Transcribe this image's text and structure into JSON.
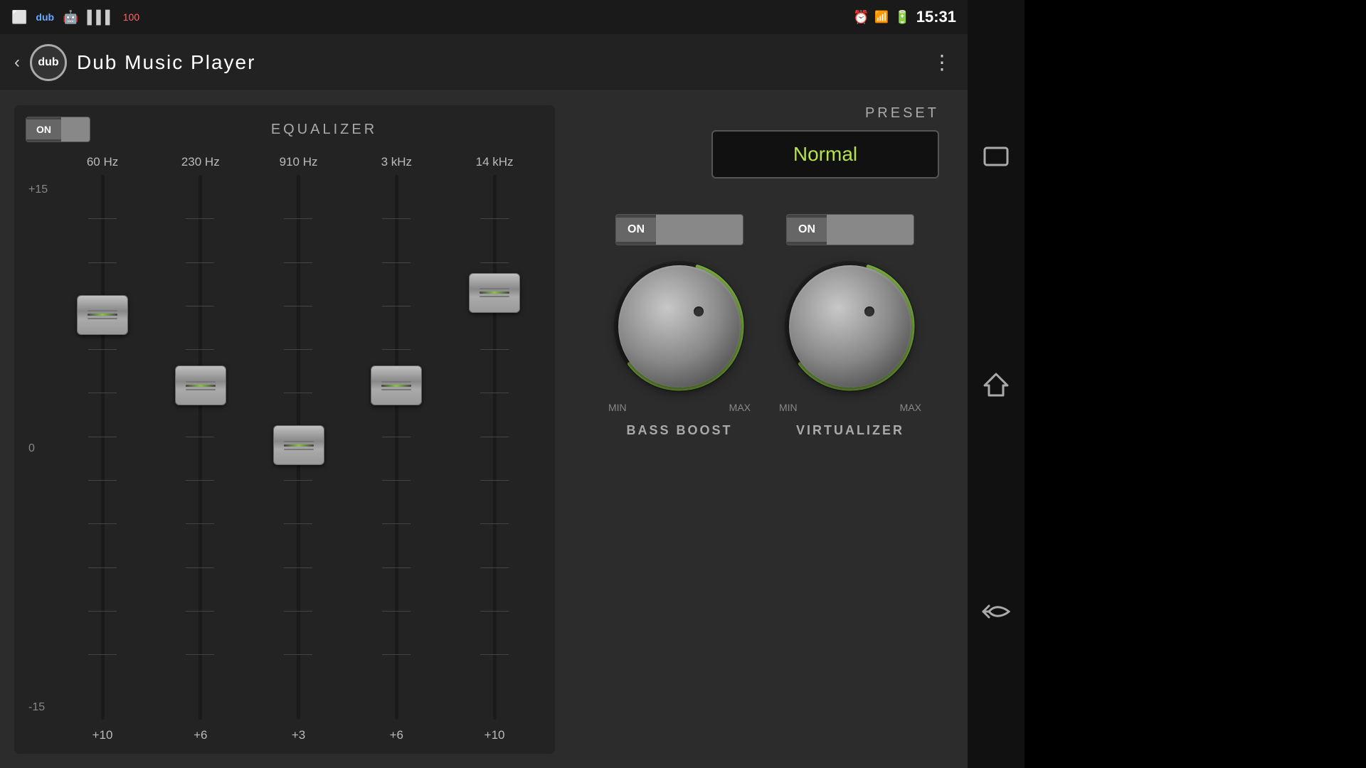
{
  "statusBar": {
    "time": "15:31",
    "icons": [
      "alarm-icon",
      "signal-icon",
      "battery-icon"
    ]
  },
  "header": {
    "appName": "Dub Music Player",
    "logo": "dub",
    "menuIcon": "⋮"
  },
  "equalizer": {
    "toggleLabel": "ON",
    "sectionLabel": "EQUALIZER",
    "presetLabel": "PRESET",
    "presetValue": "Normal",
    "bands": [
      {
        "freq": "60 Hz",
        "value": "+10",
        "position": 25
      },
      {
        "freq": "230 Hz",
        "value": "+6",
        "position": 40
      },
      {
        "freq": "910 Hz",
        "value": "+3",
        "position": 55
      },
      {
        "freq": "3 kHz",
        "value": "+6",
        "position": 40
      },
      {
        "freq": "14 kHz",
        "value": "+10",
        "position": 20
      }
    ],
    "scaleLabels": [
      "+15",
      "0",
      "-15"
    ]
  },
  "bassBoost": {
    "toggleLabel": "ON",
    "minLabel": "MIN",
    "maxLabel": "MAX",
    "name": "BASS BOOST",
    "knobPosition": 65
  },
  "virtualizer": {
    "toggleLabel": "ON",
    "minLabel": "MIN",
    "maxLabel": "MAX",
    "name": "VIRTUALIZER",
    "knobPosition": 65
  },
  "navigation": {
    "buttons": [
      "recent-apps-icon",
      "home-icon",
      "back-icon"
    ]
  }
}
